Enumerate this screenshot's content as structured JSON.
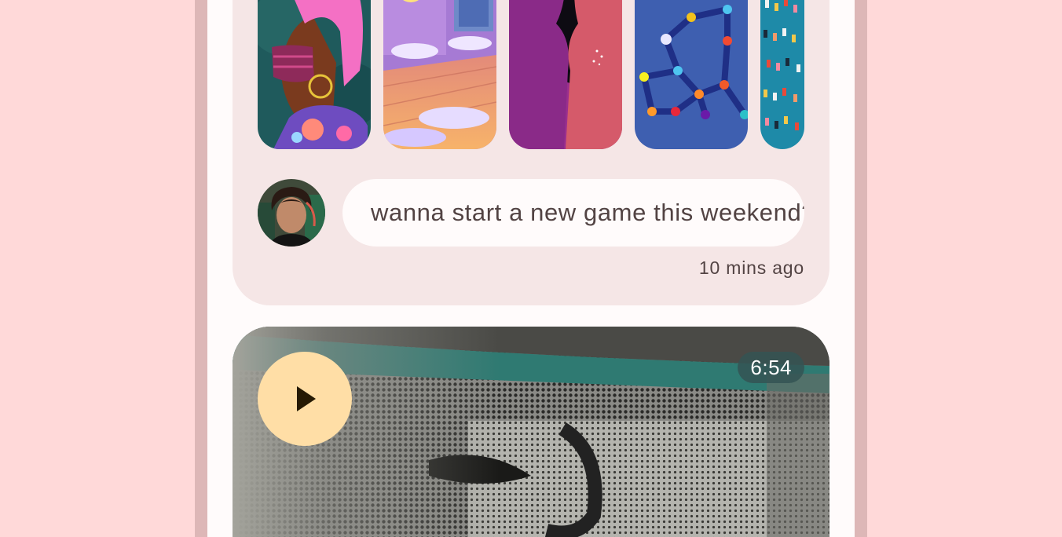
{
  "message": {
    "text": "wanna start a new game this weekend?",
    "timestamp": "10 mins ago"
  },
  "video": {
    "duration": "6:54"
  },
  "icons": {
    "play": "play-icon"
  }
}
